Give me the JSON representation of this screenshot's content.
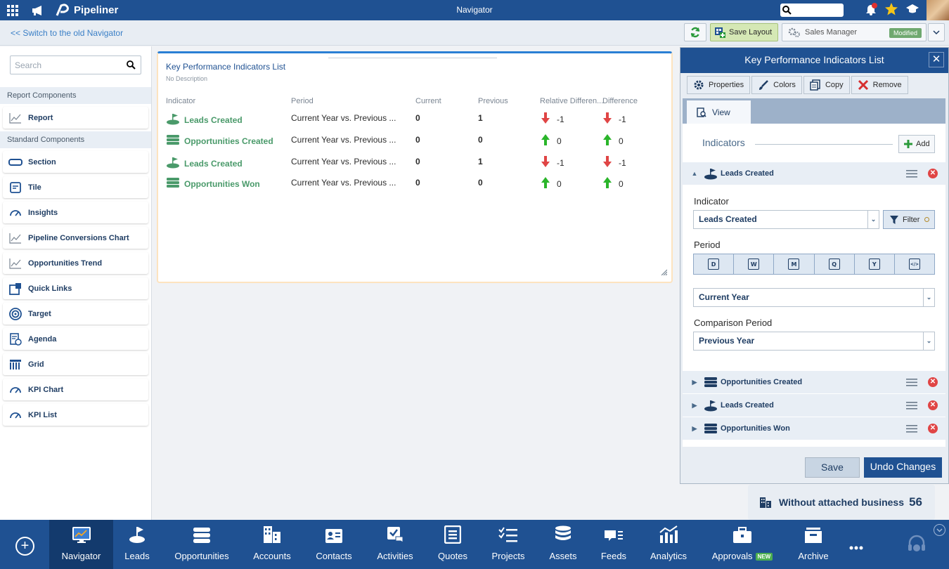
{
  "app": {
    "brand": "Pipeliner",
    "window_title": "Navigator"
  },
  "subbar": {
    "switch_link": "<< Switch to the old Navigator",
    "save_layout": "Save Layout",
    "profile": "Sales Manager",
    "profile_badge": "Modified"
  },
  "left": {
    "search_placeholder": "Search",
    "report_section": "Report Components",
    "report_items": [
      "Report"
    ],
    "standard_section": "Standard Components",
    "standard_items": [
      "Section",
      "Tile",
      "Insights",
      "Pipeline Conversions Chart",
      "Opportunities Trend",
      "Quick Links",
      "Target",
      "Agenda",
      "Grid",
      "KPI Chart",
      "KPI List"
    ]
  },
  "card": {
    "title": "Key Performance Indicators List",
    "description": "No Description",
    "headers": {
      "indicator": "Indicator",
      "period": "Period",
      "current": "Current",
      "previous": "Previous",
      "relative": "Relative Differen...",
      "difference": "Difference"
    },
    "rows": [
      {
        "indicator": "Leads Created",
        "period": "Current Year vs. Previous ...",
        "current": "0",
        "previous": "1",
        "relative": "-1",
        "difference": "-1"
      },
      {
        "indicator": "Opportunities Created",
        "period": "Current Year vs. Previous ...",
        "current": "0",
        "previous": "0",
        "relative": "0",
        "difference": "0"
      },
      {
        "indicator": "Leads Created",
        "period": "Current Year vs. Previous ...",
        "current": "0",
        "previous": "1",
        "relative": "-1",
        "difference": "-1"
      },
      {
        "indicator": "Opportunities Won",
        "period": "Current Year vs. Previous ...",
        "current": "0",
        "previous": "0",
        "relative": "0",
        "difference": "0"
      }
    ]
  },
  "panel": {
    "title": "Key Performance Indicators List",
    "toolbar": {
      "properties": "Properties",
      "colors": "Colors",
      "copy": "Copy",
      "remove": "Remove"
    },
    "view_tab": "View",
    "indicators_heading": "Indicators",
    "add_label": "Add",
    "expanded": {
      "name": "Leads Created",
      "indicator_label": "Indicator",
      "indicator_value": "Leads Created",
      "filter_label": "Filter",
      "period_label": "Period",
      "period_buttons": [
        "D",
        "W",
        "M",
        "Q",
        "Y",
        "</>"
      ],
      "period_value": "Current Year",
      "comparison_label": "Comparison Period",
      "comparison_value": "Previous Year"
    },
    "collapsed": [
      "Opportunities Created",
      "Leads Created",
      "Opportunities Won"
    ],
    "save": "Save",
    "undo": "Undo Changes"
  },
  "tile": {
    "label": "Without attached business",
    "value": "56"
  },
  "bottom_nav": [
    "Navigator",
    "Leads",
    "Opportunities",
    "Accounts",
    "Contacts",
    "Activities",
    "Quotes",
    "Projects",
    "Assets",
    "Feeds",
    "Analytics",
    "Approvals",
    "Archive"
  ],
  "bottom_badge": "NEW",
  "colors": {
    "primary": "#1f5192",
    "accent_green": "#4a9a6a",
    "down_red": "#e04545",
    "up_green": "#2ab52a"
  }
}
